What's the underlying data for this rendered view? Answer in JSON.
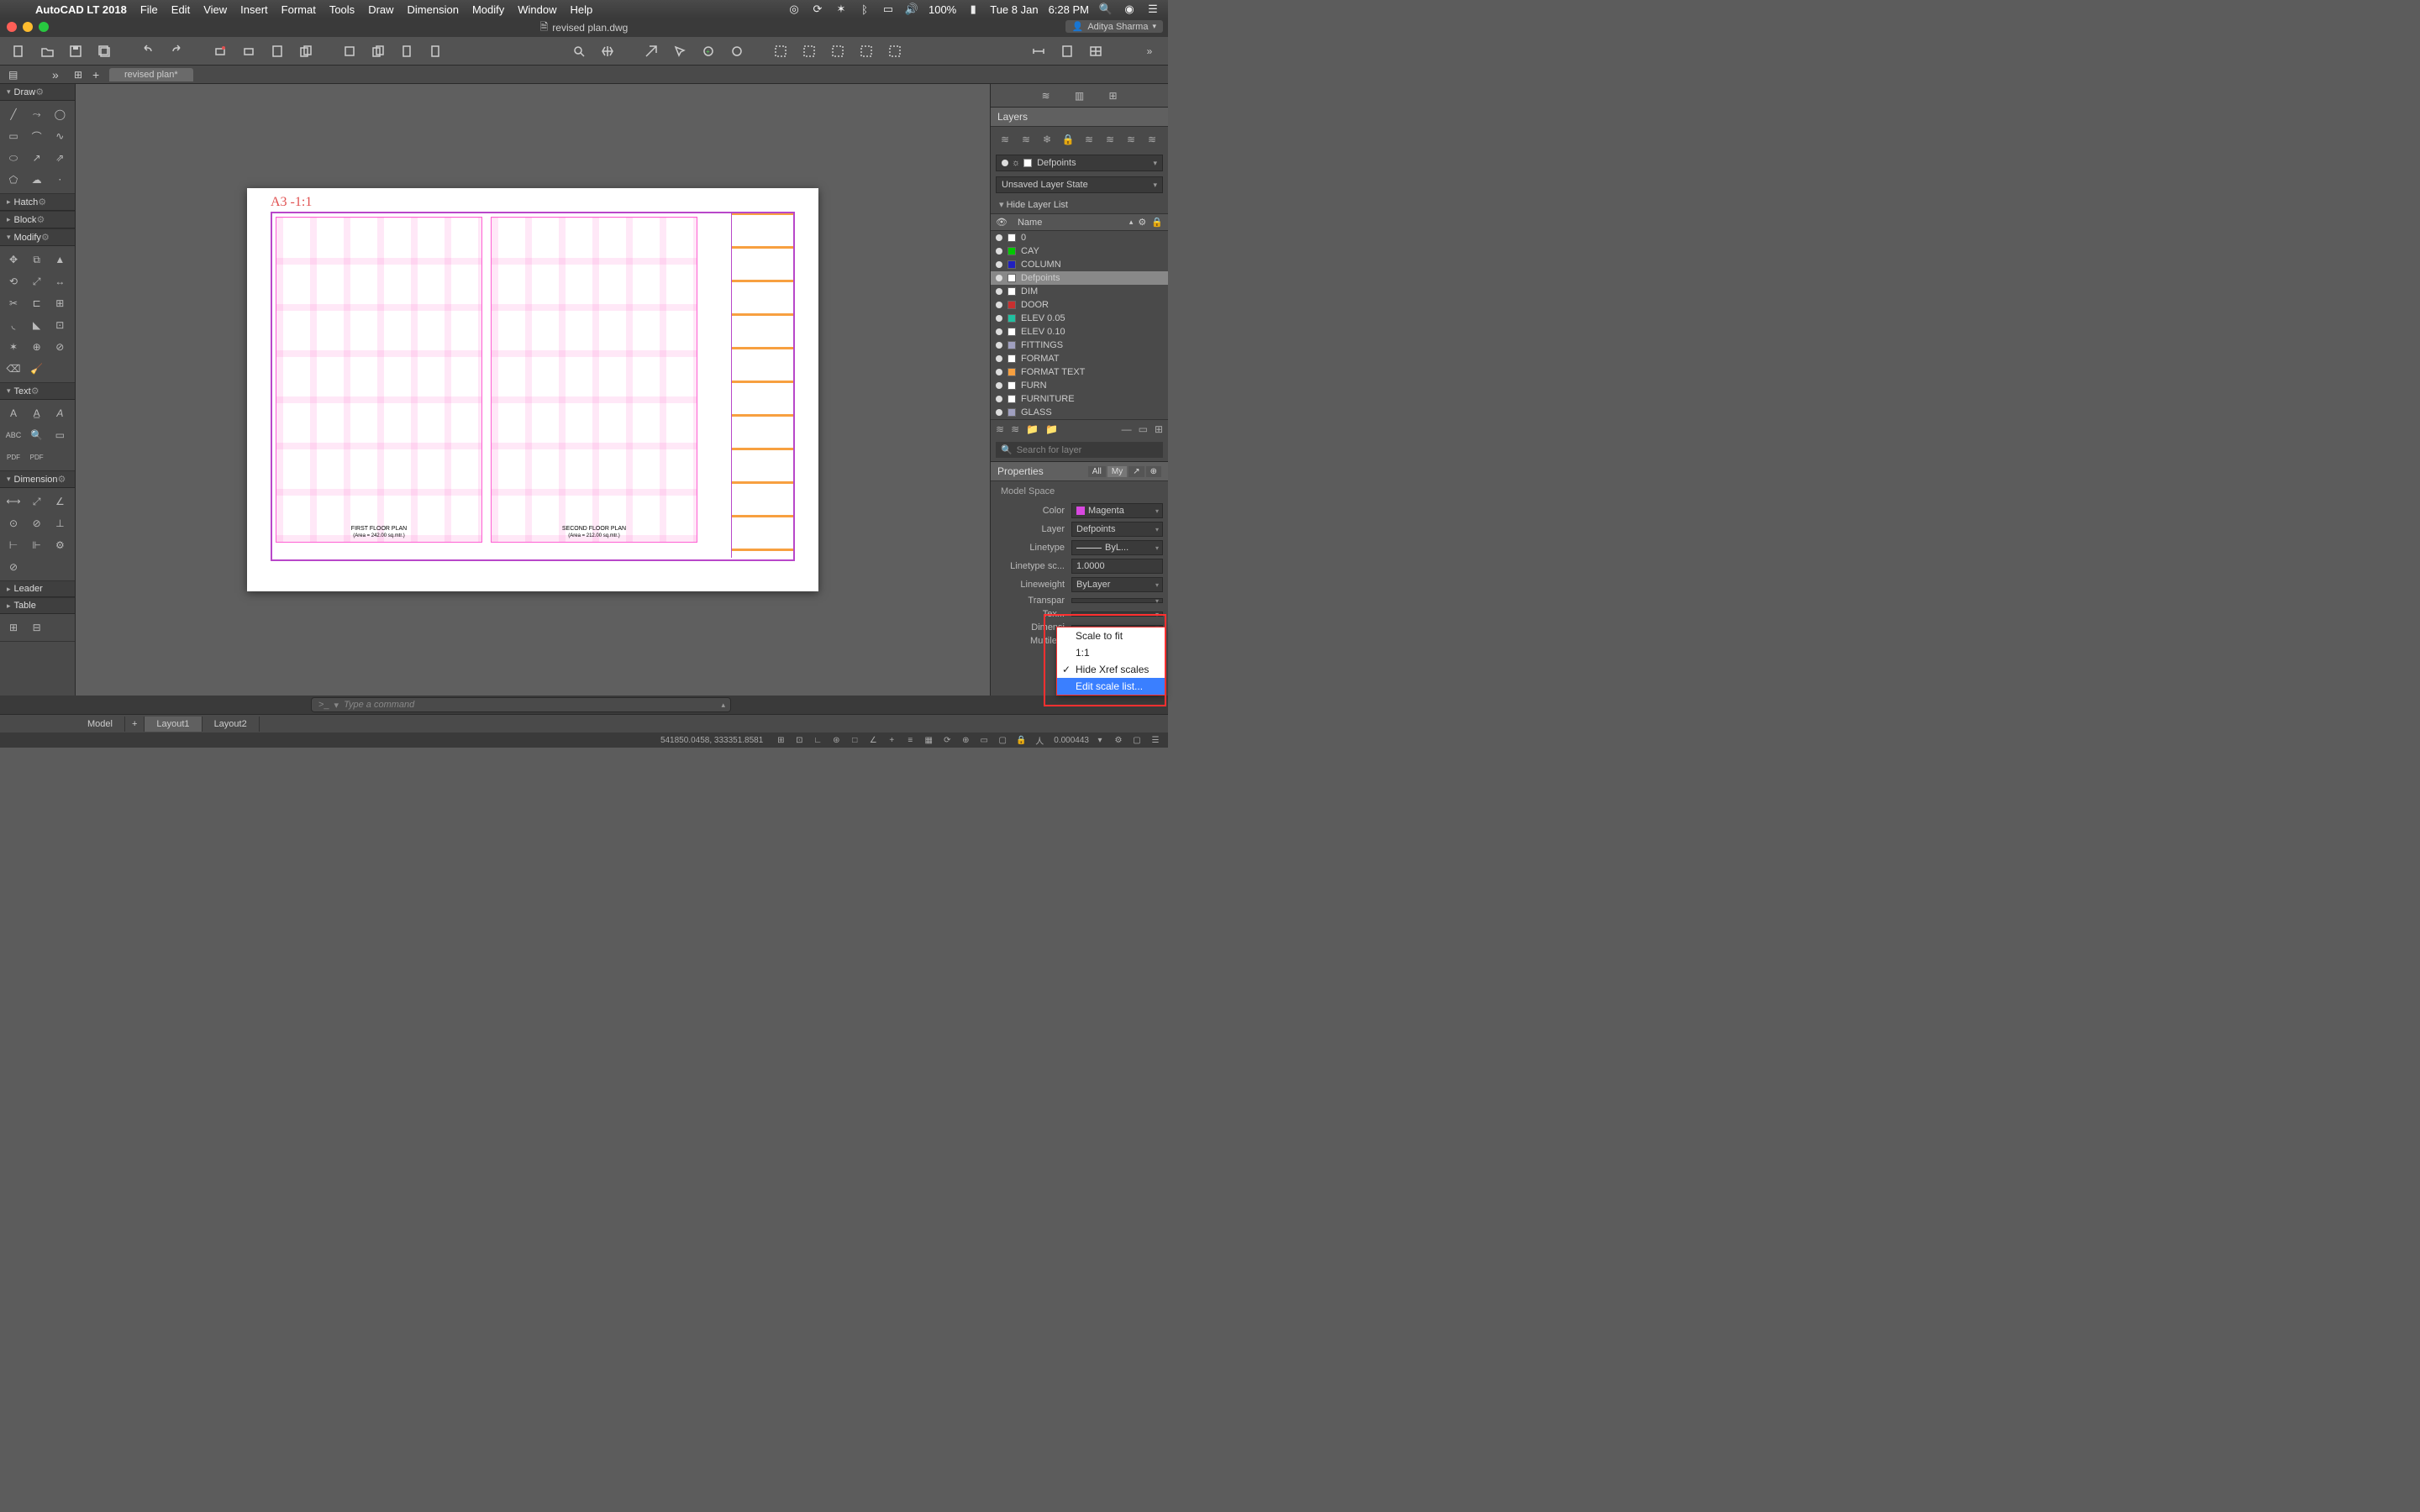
{
  "menubar": {
    "app": "AutoCAD LT 2018",
    "items": [
      "File",
      "Edit",
      "View",
      "Insert",
      "Format",
      "Tools",
      "Draw",
      "Dimension",
      "Modify",
      "Window",
      "Help"
    ],
    "battery": "100%",
    "date": "Tue 8 Jan",
    "time": "6:28 PM"
  },
  "title": {
    "filename": "revised plan.dwg",
    "user": "Aditya Sharma"
  },
  "file_tab": "revised plan*",
  "left_sections": {
    "draw": "Draw",
    "hatch": "Hatch",
    "block": "Block",
    "modify": "Modify",
    "text": "Text",
    "dimension": "Dimension",
    "leader": "Leader",
    "table": "Table"
  },
  "paper": {
    "a3": "A3 -1:1",
    "plan1_title": "FIRST FLOOR PLAN",
    "plan1_sub": "(Area = 242.00 sq.mtr.)",
    "plan2_title": "SECOND FLOOR PLAN",
    "plan2_sub": "(Area = 212.00 sq.mtr.)"
  },
  "layers_panel": {
    "title": "Layers",
    "current": "Defpoints",
    "state": "Unsaved Layer State",
    "hide": "Hide Layer List",
    "col_name": "Name",
    "search_ph": "Search for layer",
    "items": [
      {
        "name": "0",
        "color": "#ffffff"
      },
      {
        "name": "CAY",
        "color": "#00c800"
      },
      {
        "name": "COLUMN",
        "color": "#2020c0"
      },
      {
        "name": "Defpoints",
        "color": "#ffffff",
        "sel": true
      },
      {
        "name": "DIM",
        "color": "#ffffff"
      },
      {
        "name": "DOOR",
        "color": "#c83030"
      },
      {
        "name": "ELEV 0.05",
        "color": "#20c0a0"
      },
      {
        "name": "ELEV 0.10",
        "color": "#ffffff"
      },
      {
        "name": "FITTINGS",
        "color": "#a0a0c0"
      },
      {
        "name": "FORMAT",
        "color": "#ffffff"
      },
      {
        "name": "FORMAT TEXT",
        "color": "#f7a040"
      },
      {
        "name": "FURN",
        "color": "#ffffff"
      },
      {
        "name": "FURNITURE",
        "color": "#ffffff"
      },
      {
        "name": "GLASS",
        "color": "#a0a0c0"
      }
    ]
  },
  "properties": {
    "title": "Properties",
    "tab_all": "All",
    "tab_my": "My",
    "space": "Model Space",
    "rows": {
      "color_lbl": "Color",
      "color_val": "Magenta",
      "color_hex": "#d848e0",
      "layer_lbl": "Layer",
      "layer_val": "Defpoints",
      "linetype_lbl": "Linetype",
      "linetype_val": "ByL...",
      "ltscale_lbl": "Linetype sc...",
      "ltscale_val": "1.0000",
      "lweight_lbl": "Lineweight",
      "lweight_val": "ByLayer",
      "transp_lbl": "Transpar",
      "txt_lbl": "Tex...",
      "dim_lbl": "Dimensi",
      "ml_lbl": "Multile..."
    }
  },
  "scale_popup": {
    "fit": "Scale to fit",
    "one": "1:1",
    "hide": "Hide Xref scales",
    "edit": "Edit scale list..."
  },
  "cmd": {
    "placeholder": "Type a command",
    "prompt": ">_"
  },
  "model_tabs": {
    "model": "Model",
    "l1": "Layout1",
    "l2": "Layout2"
  },
  "status": {
    "coords": "541850.0458, 333351.8581",
    "scale": "0.000443"
  }
}
